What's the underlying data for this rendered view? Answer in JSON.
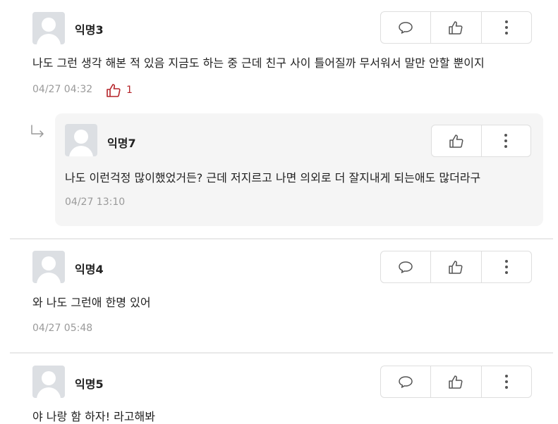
{
  "comments": [
    {
      "author": "익명3",
      "text": "나도 그런 생각 해본 적 있음 지금도 하는 중 근데 친구 사이 틀어질까 무서워서 말만 안할 뿐이지",
      "time": "04/27 04:32",
      "likes": "1"
    },
    {
      "author": "익명7",
      "text": "나도 이런걱정 많이했었거든? 근데 저지르고 나면 의외로 더 잘지내게 되는애도 많더라구",
      "time": "04/27 13:10"
    },
    {
      "author": "익명4",
      "text": "와 나도 그런애 한명 있어",
      "time": "04/27 05:48"
    },
    {
      "author": "익명5",
      "text": "야 나랑 함 하자! 라고해봐"
    }
  ],
  "icons": {
    "reply": "speech-bubble-icon",
    "like": "thumbs-up-icon",
    "more": "more-vertical-icon",
    "reply_indicator": "reply-arrow-icon",
    "avatar": "default-avatar-icon"
  }
}
